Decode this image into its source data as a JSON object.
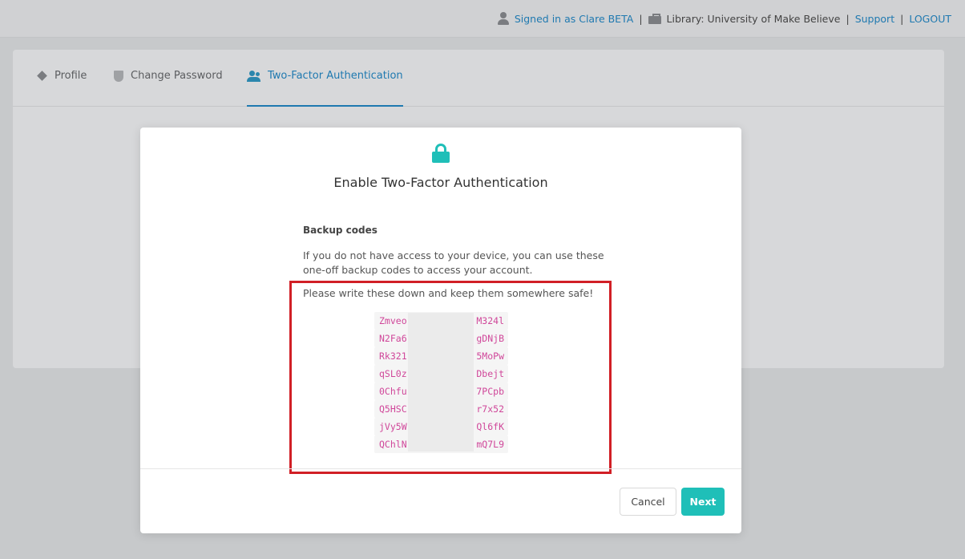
{
  "topbar": {
    "user_icon": "user-icon",
    "signed_in": "Signed in as Clare BETA",
    "sep1": "|",
    "library_icon": "briefcase-icon",
    "library": "Library: University of Make Believe",
    "sep2": "|",
    "support": "Support",
    "sep3": "|",
    "logout": "LOGOUT"
  },
  "tabs": [
    {
      "label": "Profile",
      "icon": "layers-icon"
    },
    {
      "label": "Change Password",
      "icon": "shield-icon"
    },
    {
      "label": "Two-Factor Authentication",
      "icon": "users-icon",
      "active": true
    }
  ],
  "modal": {
    "icon": "lock-icon",
    "title": "Enable Two-Factor Authentication",
    "section_title": "Backup codes",
    "description": "If you do not have access to your device, you can use these one-off backup codes to access your account.",
    "note": "Please write these down and keep them somewhere safe!",
    "codes": [
      {
        "start": "Zmveo",
        "end": "M324l"
      },
      {
        "start": "N2Fa6",
        "end": "gDNjB"
      },
      {
        "start": "Rk321",
        "end": "5MoPw"
      },
      {
        "start": "qSL0z",
        "end": "Dbejt"
      },
      {
        "start": "0Chfu",
        "end": "7PCpb"
      },
      {
        "start": "Q5HSC",
        "end": "r7x52"
      },
      {
        "start": "jVy5W",
        "end": "Ql6fK"
      },
      {
        "start": "QChlN",
        "end": "mQ7L9"
      }
    ],
    "cancel_label": "Cancel",
    "next_label": "Next"
  },
  "colors": {
    "accent": "#1fbfb8",
    "link": "#1f79b0",
    "highlight_border": "#d11f26",
    "code_text": "#d0479a"
  }
}
